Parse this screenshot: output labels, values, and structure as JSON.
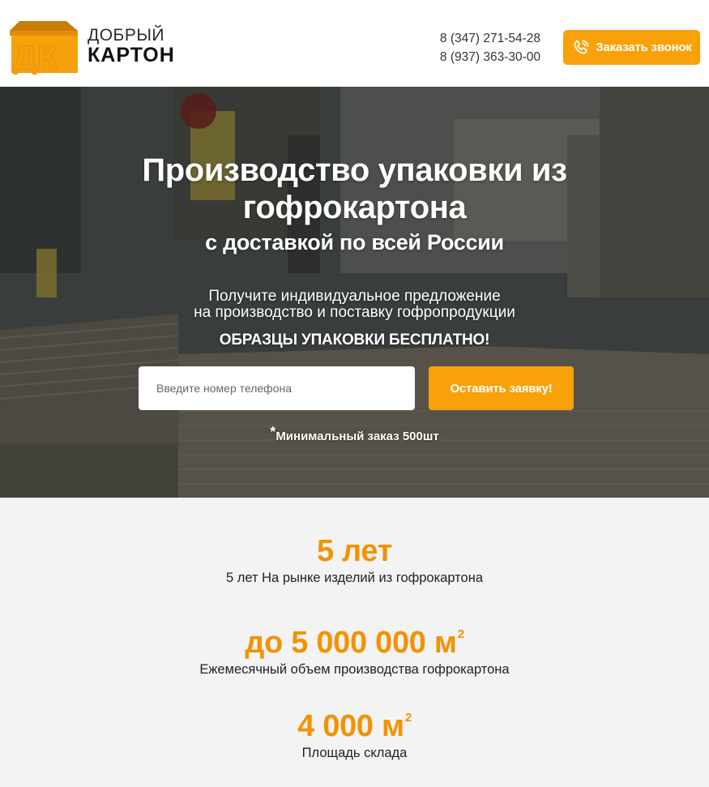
{
  "header": {
    "logo": {
      "mark": "ДК",
      "line1": "ДОБРЫЙ",
      "line2": "КАРТОН"
    },
    "phones": [
      "8 (347) 271-54-28",
      "8 (937) 363-30-00"
    ],
    "call_button_label": "Заказать звонок",
    "call_icon": "phone-ringing-icon"
  },
  "hero": {
    "title_line1": "Производство упаковки из",
    "title_line2": "гофрокартона",
    "subtitle": "с доставкой по всей России",
    "offer_line1": "Получите индивидуальное предложение",
    "offer_line2": "на производство и поставку гофропродукции",
    "free_samples": "ОБРАЗЦЫ УПАКОВКИ БЕСПЛАТНО!",
    "phone_placeholder": "Введите номер телефона",
    "submit_label": "Оставить заявку!",
    "min_order_star": "*",
    "min_order": "Минимальный заказ 500шт"
  },
  "stats": [
    {
      "value": "5 лет",
      "unit_sup": "",
      "label": "5 лет На рынке изделий из гофрокартона"
    },
    {
      "value": "до 5 000 000 м",
      "unit_sup": "2",
      "label": "Ежемесячный объем производства гофрокартона"
    },
    {
      "value": "4 000 м",
      "unit_sup": "2",
      "label": "Площадь склада"
    }
  ],
  "colors": {
    "accent": "#f9a10a",
    "stat_value": "#f39200",
    "stats_background": "#f3f3f3"
  }
}
